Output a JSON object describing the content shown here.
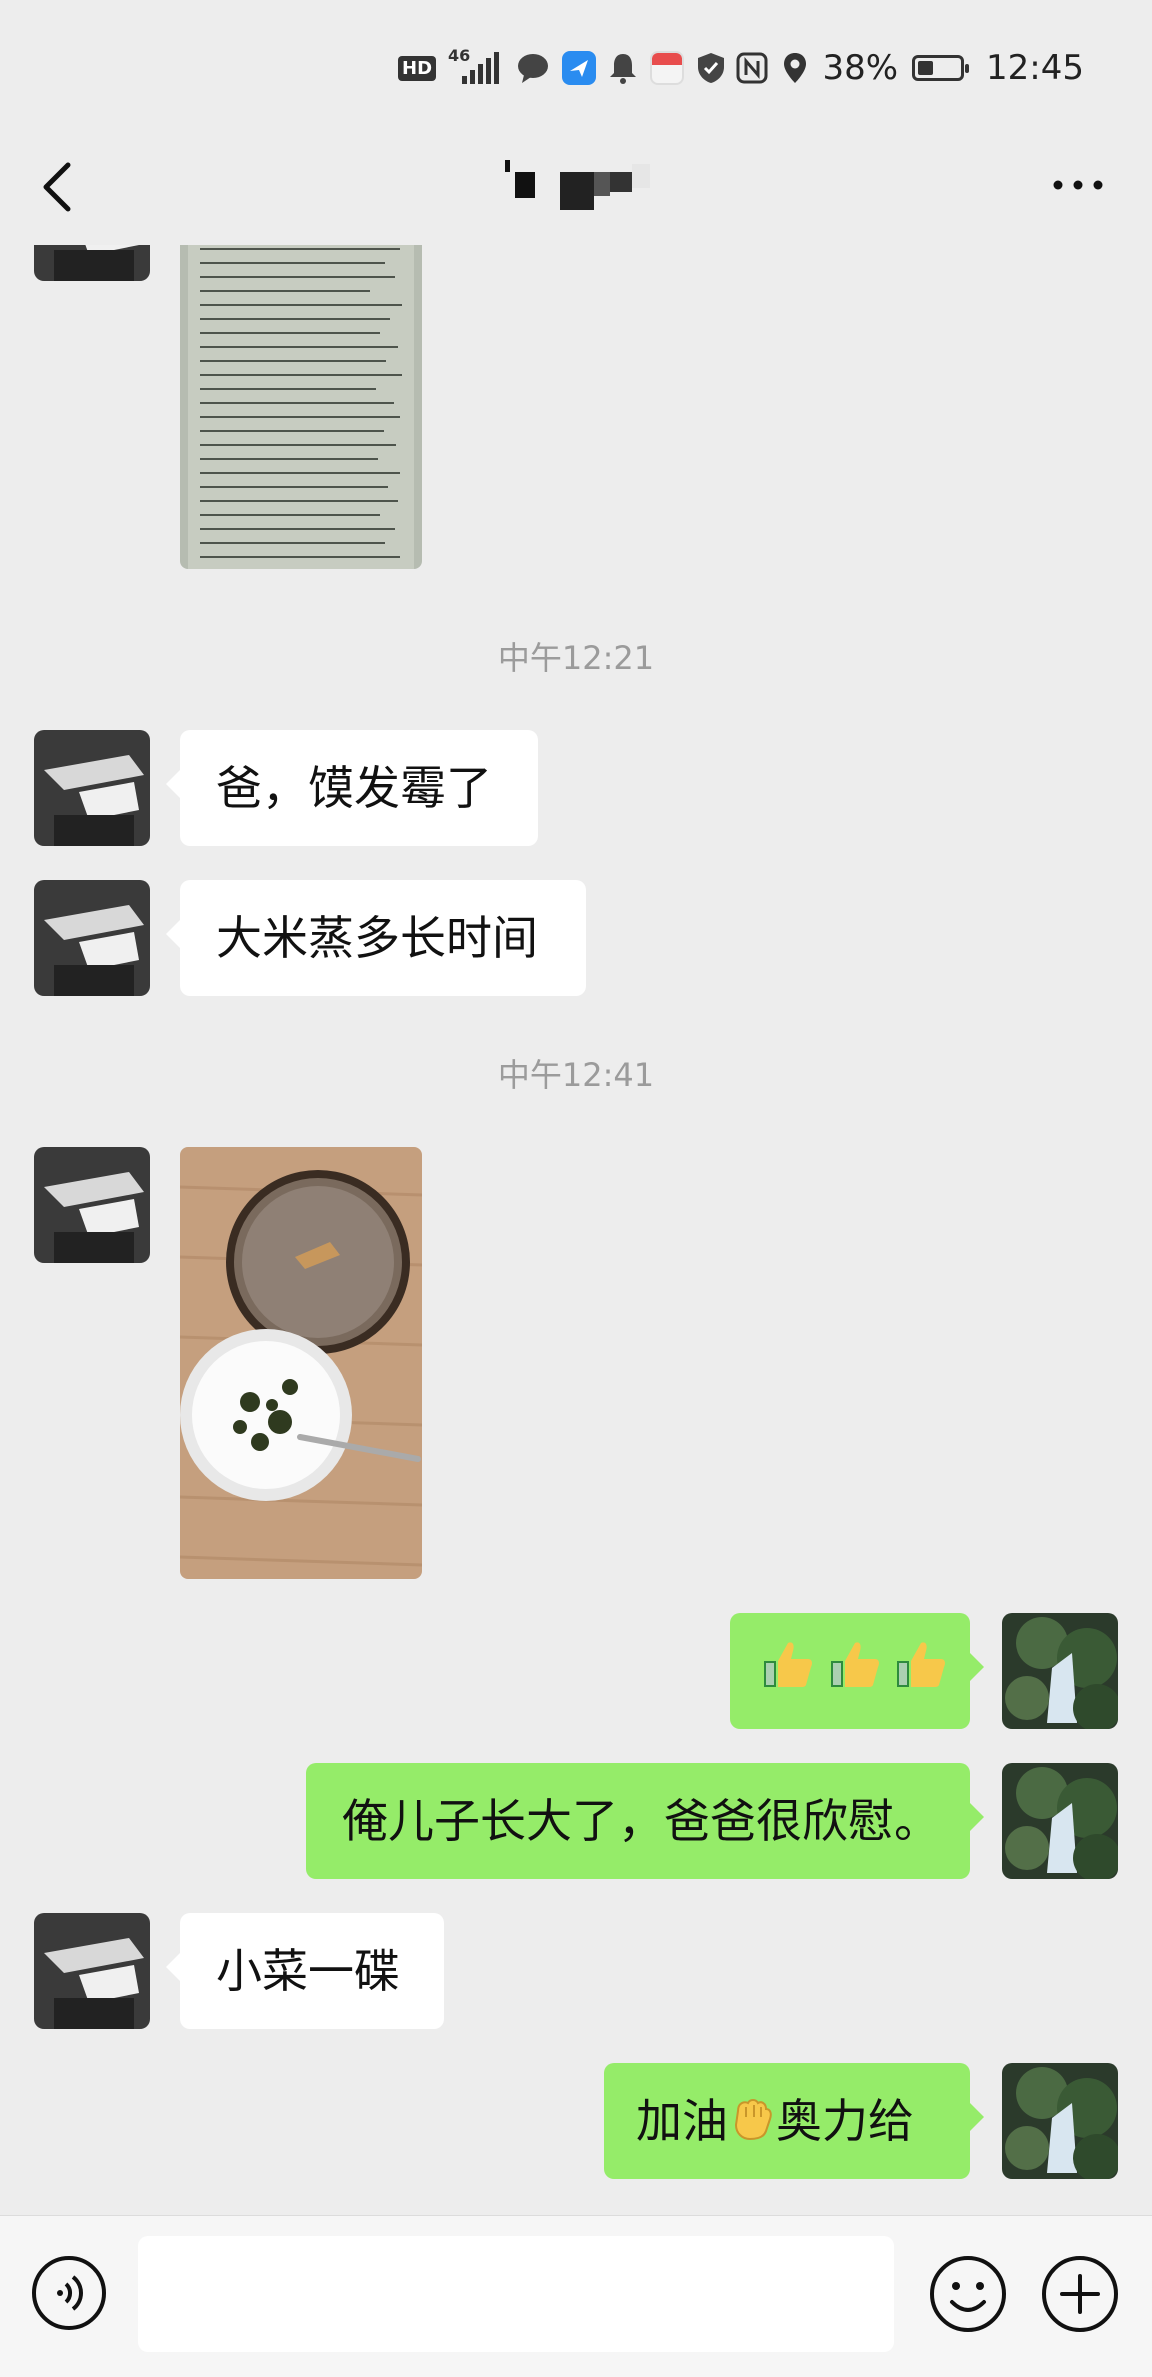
{
  "status_bar": {
    "network_tag": "HD",
    "network_gen": "46",
    "battery_percent": "38%",
    "battery_level": 0.38,
    "time": "12:45"
  },
  "header": {
    "back_icon": "chevron-left-icon",
    "more_icon": "more-dots-icon"
  },
  "chat": {
    "timestamps": [
      "中午12:21",
      "中午12:41"
    ],
    "messages": [
      {
        "side": "in",
        "type": "image",
        "desc": "document-photo"
      },
      {
        "side": "in",
        "type": "text",
        "text": "爸，馍发霉了"
      },
      {
        "side": "in",
        "type": "text",
        "text": "大米蒸多长时间"
      },
      {
        "side": "in",
        "type": "image",
        "desc": "food-photo"
      },
      {
        "side": "out",
        "type": "emoji",
        "emoji_names": [
          "thumbs-up-icon",
          "thumbs-up-icon",
          "thumbs-up-icon"
        ]
      },
      {
        "side": "out",
        "type": "text",
        "text": "俺儿子长大了，爸爸很欣慰。"
      },
      {
        "side": "in",
        "type": "text",
        "text": "小菜一碟"
      },
      {
        "side": "out",
        "type": "text",
        "text_before": "加油",
        "emoji": "fist-icon",
        "text_after": "奥力给"
      }
    ]
  },
  "input_bar": {
    "voice_icon": "voice-icon",
    "emoji_icon": "smiley-icon",
    "plus_icon": "plus-circle-icon",
    "input_value": ""
  },
  "colors": {
    "background": "#ededed",
    "incoming_bubble": "#ffffff",
    "outgoing_bubble": "#95ec69",
    "timestamp_text": "#9b9b9b"
  }
}
